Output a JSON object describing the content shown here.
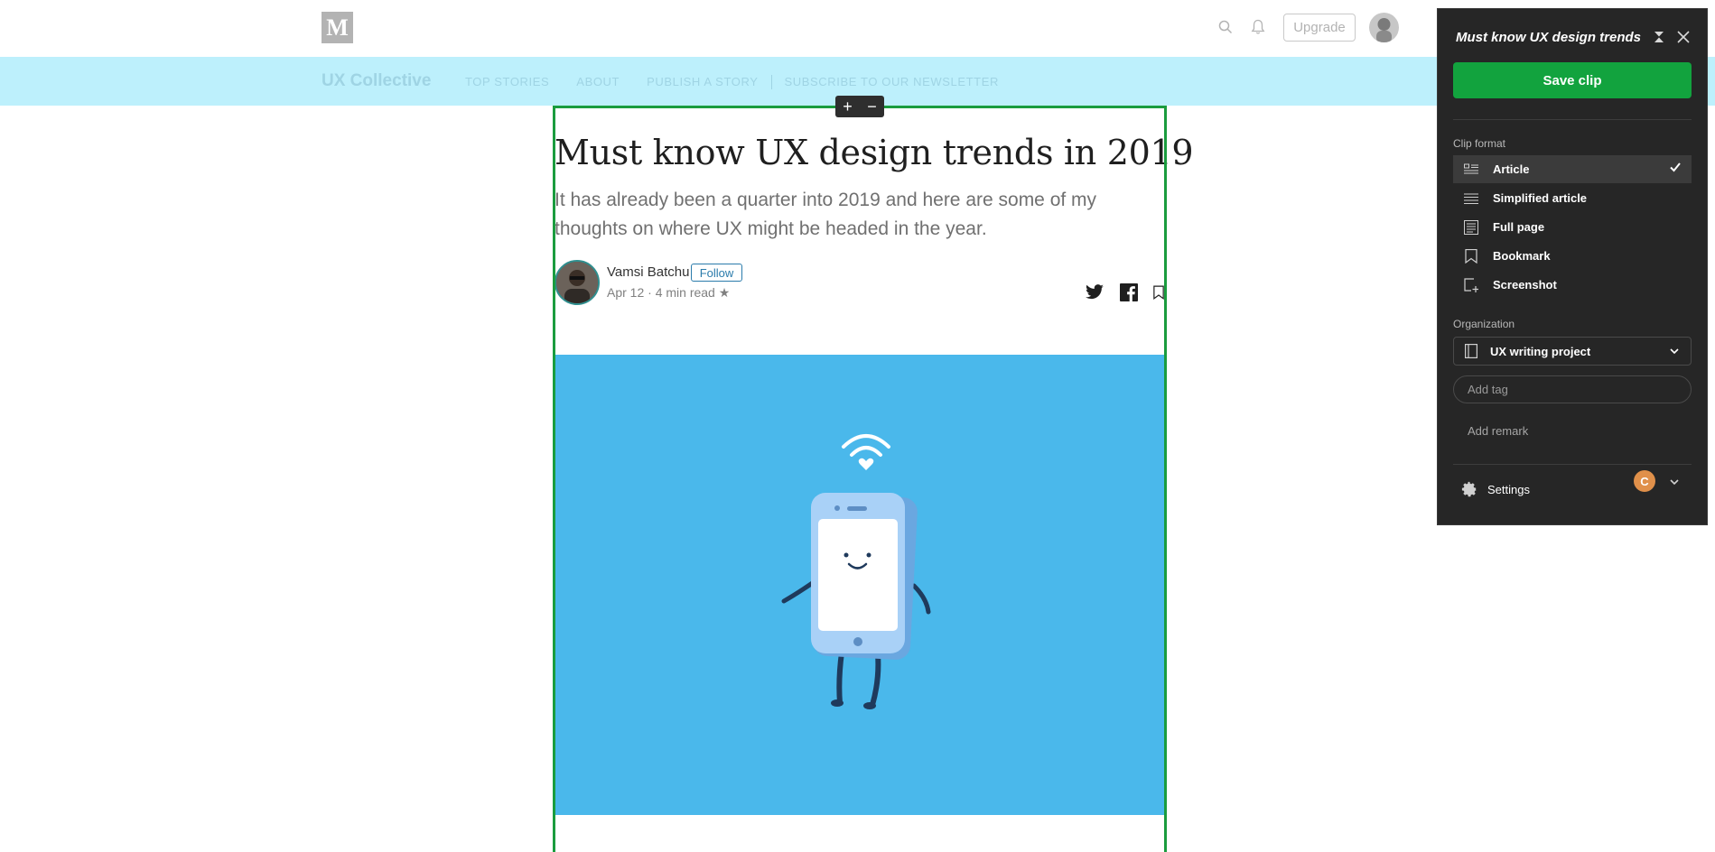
{
  "medium": {
    "logo_letter": "M",
    "upgrade_label": "Upgrade"
  },
  "publication": {
    "name": "UX Collective",
    "nav": [
      "TOP STORIES",
      "ABOUT",
      "PUBLISH A STORY",
      "SUBSCRIBE TO OUR NEWSLETTER"
    ]
  },
  "article": {
    "title": "Must know UX design trends in 2019",
    "subtitle": "It has already been a quarter into 2019 and here are some of my thoughts on where UX might be headed in the year.",
    "author": "Vamsi Batchu",
    "follow_label": "Follow",
    "meta": "Apr 12 · 4 min read ★"
  },
  "clipper": {
    "title": "Must know UX design trends in",
    "save_label": "Save clip",
    "clip_format_label": "Clip format",
    "formats": [
      {
        "label": "Article",
        "selected": true
      },
      {
        "label": "Simplified article",
        "selected": false
      },
      {
        "label": "Full page",
        "selected": false
      },
      {
        "label": "Bookmark",
        "selected": false
      },
      {
        "label": "Screenshot",
        "selected": false
      }
    ],
    "organization_label": "Organization",
    "notebook": "UX writing project",
    "tag_placeholder": "Add tag",
    "remark_label": "Add remark",
    "settings_label": "Settings",
    "account_initial": "C"
  },
  "colors": {
    "save_green": "#12a33e",
    "selection_green": "#1a9c3e",
    "pub_bar": "#bdf0fc",
    "hero_blue": "#4ab8eb"
  }
}
